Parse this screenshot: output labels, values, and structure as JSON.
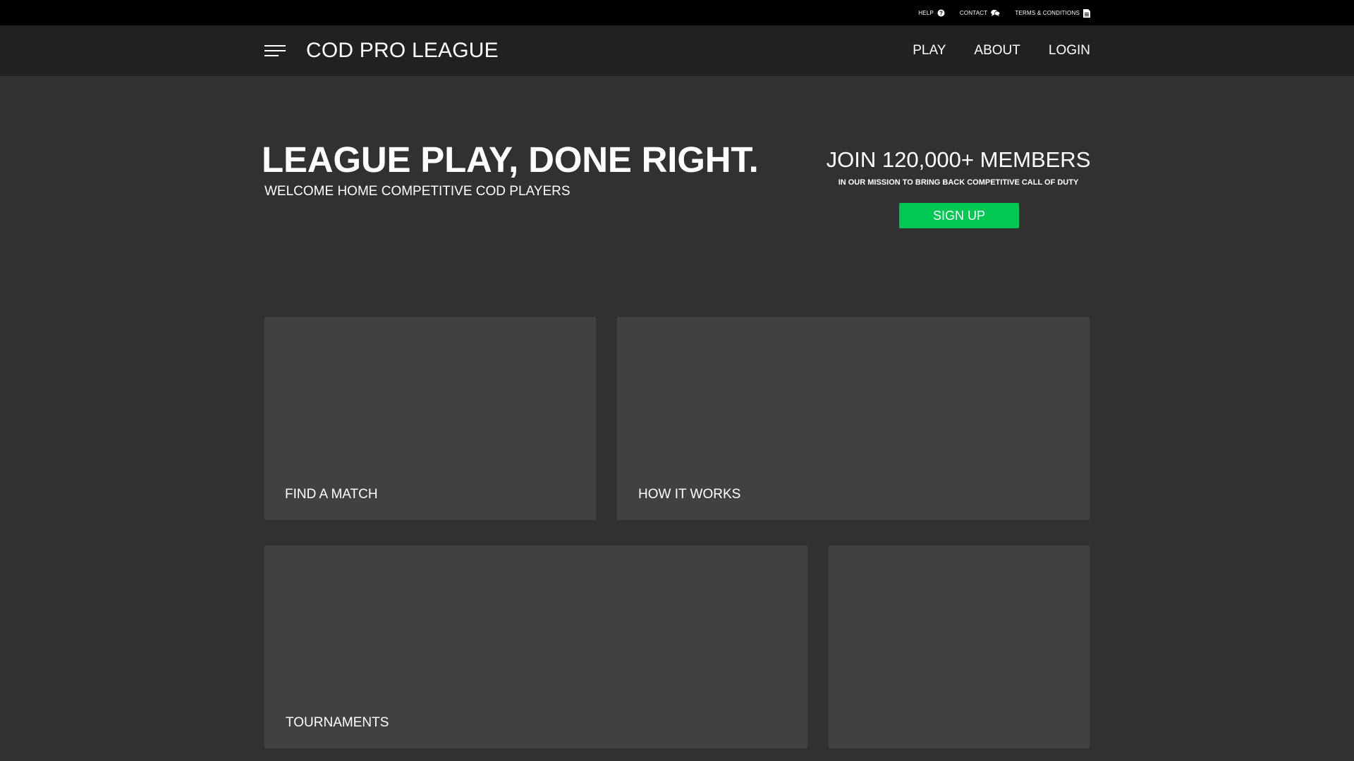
{
  "utility": {
    "links": [
      {
        "label": "HELP",
        "icon": "question-circle-icon"
      },
      {
        "label": "CONTACT",
        "icon": "chat-icon"
      },
      {
        "label": "TERMS & CONDITIONS",
        "icon": "document-icon"
      }
    ]
  },
  "nav": {
    "brand": "COD PRO LEAGUE",
    "links": [
      "PLAY",
      "ABOUT",
      "LOGIN"
    ]
  },
  "hero": {
    "title": "LEAGUE PLAY, DONE RIGHT.",
    "subtitle": "WELCOME HOME COMPETITIVE COD PLAYERS",
    "join_title": "JOIN 120,000+ MEMBERS",
    "join_subtitle": "IN OUR MISSION TO BRING BACK COMPETITIVE CALL OF DUTY",
    "signup_label": "SIGN UP"
  },
  "cards": [
    {
      "label": "FIND A MATCH"
    },
    {
      "label": "HOW IT WORKS"
    },
    {
      "label": "TOURNAMENTS"
    },
    {
      "label": ""
    }
  ],
  "colors": {
    "background": "#313131",
    "utility_bar": "#000000",
    "nav_bar": "#212121",
    "card": "#414141",
    "accent": "#00c853"
  }
}
